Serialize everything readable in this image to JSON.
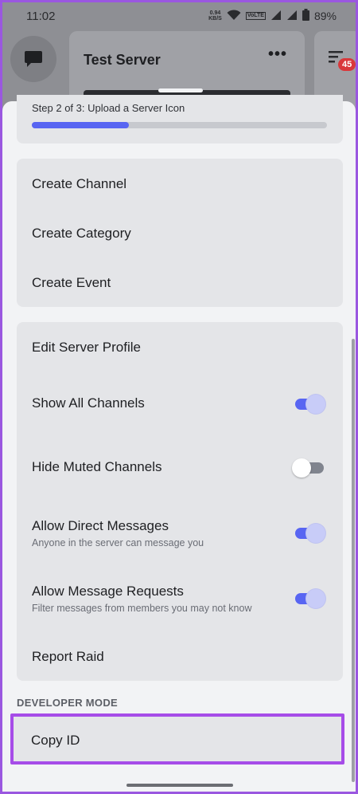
{
  "status_bar": {
    "time": "11:02",
    "speed_value": "0.94",
    "speed_unit": "KB/S",
    "network": "VoLTE",
    "battery": "89%"
  },
  "background": {
    "server_name": "Test Server",
    "more": "•••",
    "notification_count": "45"
  },
  "sheet": {
    "progress": {
      "label": "Step 2 of 3: Upload a Server Icon",
      "value": 0.33
    },
    "create_group": [
      {
        "label": "Create Channel"
      },
      {
        "label": "Create Category"
      },
      {
        "label": "Create Event"
      }
    ],
    "settings_group": {
      "edit_profile": "Edit Server Profile",
      "show_all_channels": {
        "label": "Show All Channels",
        "on": true
      },
      "hide_muted": {
        "label": "Hide Muted Channels",
        "on": false
      },
      "allow_dm": {
        "label": "Allow Direct Messages",
        "sub": "Anyone in the server can message you",
        "on": true
      },
      "allow_requests": {
        "label": "Allow Message Requests",
        "sub": "Filter messages from members you may not know",
        "on": true
      },
      "report_raid": "Report Raid"
    },
    "developer_section": "DEVELOPER MODE",
    "copy_id": "Copy ID"
  },
  "colors": {
    "accent": "#5865f2",
    "highlight_border": "#a64ce8"
  }
}
